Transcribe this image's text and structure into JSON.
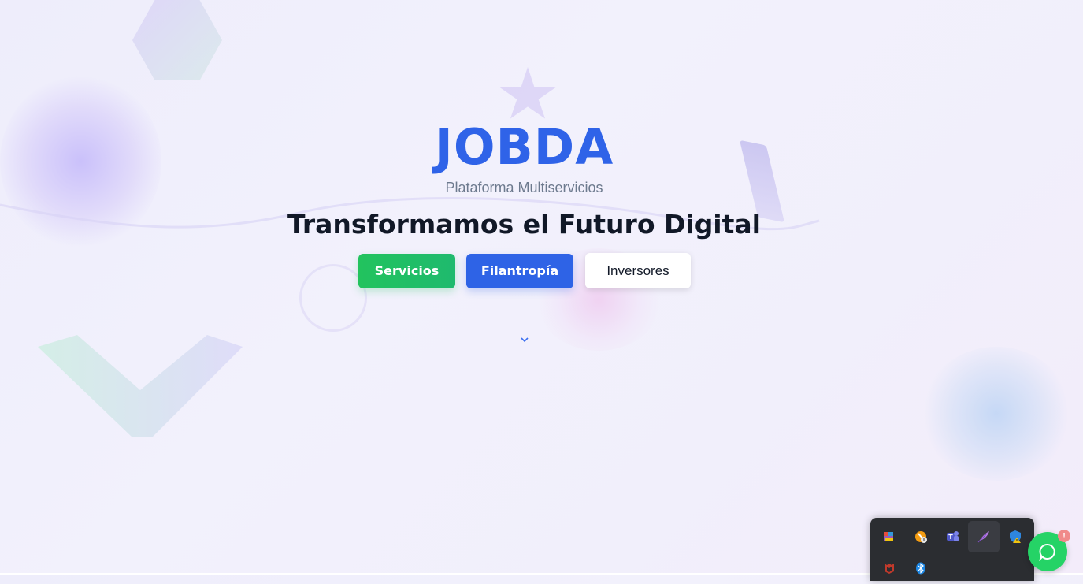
{
  "hero": {
    "logo": "JOBDA",
    "subtitle": "Plataforma Multiservicios",
    "headline": "Transformamos el Futuro Digital"
  },
  "buttons": {
    "services": "Servicios",
    "philanthropy": "Filantropía",
    "investors": "Inversores"
  },
  "whatsapp": {
    "badge": "!"
  },
  "colors": {
    "brand_blue": "#2f63e8",
    "green": "#22c35e",
    "whatsapp": "#25d366"
  },
  "tray_icons": [
    "picpick-icon",
    "vlc-alert-icon",
    "teams-icon",
    "feather-icon",
    "defender-warning-icon",
    "mcafee-icon",
    "bluetooth-icon"
  ]
}
